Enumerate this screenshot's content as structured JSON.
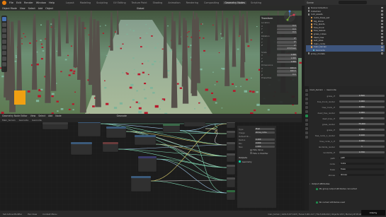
{
  "topbar": {
    "menus": [
      "File",
      "Edit",
      "Render",
      "Window",
      "Help"
    ],
    "workspaces": [
      "Layout",
      "Modeling",
      "Sculpting",
      "UV Editing",
      "Texture Paint",
      "Shading",
      "Animation",
      "Rendering",
      "Compositing",
      "Geometry Nodes",
      "Scripting"
    ],
    "active_workspace": "Geometry Nodes",
    "scene": "Scene",
    "view_layer": "ViewLayer"
  },
  "viewport": {
    "mode": "Object Mode",
    "menus": [
      "View",
      "Select",
      "Add",
      "Object"
    ],
    "transform_label": "Global"
  },
  "npanel": {
    "title": "Transform",
    "location": {
      "label": "Location",
      "x": "0 m",
      "y": "0 m",
      "z": "0 m"
    },
    "rotation": {
      "label": "Rotation",
      "x": "0°",
      "y": "0°",
      "z": "0°",
      "mode": "XYZ Euler"
    },
    "scale": {
      "label": "Scale",
      "x": "1.000",
      "y": "1.000",
      "z": "1.000"
    },
    "dimensions": {
      "label": "Dimensions",
      "x": "100 m",
      "y": "100 m",
      "z": "0 m"
    },
    "properties": "Properties"
  },
  "node_editor": {
    "editor_name": "Geometry Node Editor",
    "menus": [
      "View",
      "Select",
      "Add",
      "Node"
    ],
    "sub_items": [
      "Main_terrain",
      "Geonode",
      "Geonode"
    ],
    "tree_name": "Geonode",
    "panel": {
      "type_label": "Type",
      "type_value": "Pixel",
      "image_label": "Image",
      "image_value": "stone_rocks.",
      "default_label": "Default Bi...",
      "rows": [
        {
          "label": "Radius",
          "value": "0.200"
        },
        {
          "label": "Min",
          "value": "0.000"
        },
        {
          "label": "Max",
          "value": "1.000"
        }
      ],
      "checks": [
        "Hide Value",
        "Hide in Modifier"
      ],
      "outputs_label": "Outputs",
      "geometry_label": "Geometry"
    }
  },
  "outliner": {
    "search_placeholder": "",
    "rows": [
      {
        "label": "Scene Collection",
        "kind": "col",
        "selected": false
      },
      {
        "label": "Collection",
        "kind": "col",
        "selected": false
      },
      {
        "label": "rock_assets",
        "kind": "col",
        "selected": false
      },
      {
        "label": "rocks_trees_set",
        "kind": "obj",
        "selected": false
      },
      {
        "label": "big_stone",
        "kind": "obj",
        "selected": false
      },
      {
        "label": "tiny_plants",
        "kind": "obj",
        "selected": false
      },
      {
        "label": "tree_trunk",
        "kind": "obj",
        "selected": false
      },
      {
        "label": "tree_leaves",
        "kind": "obj",
        "selected": false
      },
      {
        "label": "grass_cubes",
        "kind": "obj",
        "selected": false
      },
      {
        "label": "dead_tree",
        "kind": "obj",
        "selected": false
      },
      {
        "label": "leaf_piles",
        "kind": "obj",
        "selected": false
      },
      {
        "label": "main_rocks",
        "kind": "obj",
        "selected": false
      },
      {
        "label": "main_terrain",
        "kind": "obj",
        "selected": true
      },
      {
        "label": "Geonode",
        "kind": "mod",
        "selected": true
      },
      {
        "label": "proxy_models",
        "kind": "col",
        "selected": false
      }
    ]
  },
  "properties": {
    "object_name": "main_terrain",
    "modifier_name": "Geonode",
    "rows": [
      {
        "label": "grass_cf",
        "value": "0.500",
        "text": false
      },
      {
        "label": "tree_trunk_render",
        "value": "0.000",
        "text": false
      },
      {
        "label": "tree_trunk_cf",
        "value": "0.000",
        "text": false
      },
      {
        "label": "dead_tree_render",
        "value": "0.000",
        "text": false
      },
      {
        "label": "dead_tree_cf",
        "value": "20",
        "text": false
      },
      {
        "label": "grass_render",
        "value": "75.000",
        "text": false
      },
      {
        "label": "grass_cf",
        "value": "0.000",
        "text": false
      },
      {
        "label": "tree_rocks_1_render",
        "value": "0.100",
        "text": false
      },
      {
        "label": "tree_rocks_1_cf",
        "value": "0.000",
        "text": false
      },
      {
        "label": "landslide_render",
        "value": "1",
        "text": false
      },
      {
        "label": "landslide_cf",
        "value": "0.700",
        "text": false
      },
      {
        "label": "path",
        "value": "path",
        "text": true
      },
      {
        "label": "rocks",
        "value": "rocks",
        "text": true
      },
      {
        "label": "trees",
        "value": "trees",
        "text": true
      },
      {
        "label": "stones",
        "value": "stones",
        "text": true
      }
    ],
    "dd_section": "Output Attributes",
    "notes": [
      "Mo group output attributes connected",
      "No named attributes used"
    ]
  },
  "statusbar": {
    "items": [
      "Set Active Modifier",
      "Pan View",
      "Context Menu"
    ],
    "info": "main_terrain | Verts:5,677,023 | Faces:3,001,117 | Tris:5,996,402 | Objects:1/33 | Memory:8.58 GiB"
  },
  "watermark": "Udemy",
  "colors": {
    "accent_blue": "#4772b3",
    "orange": "#e87d0d",
    "geometry_socket": "#00d6a3",
    "blood_red": "#b8172a",
    "moss_green": "#7fb49a"
  }
}
